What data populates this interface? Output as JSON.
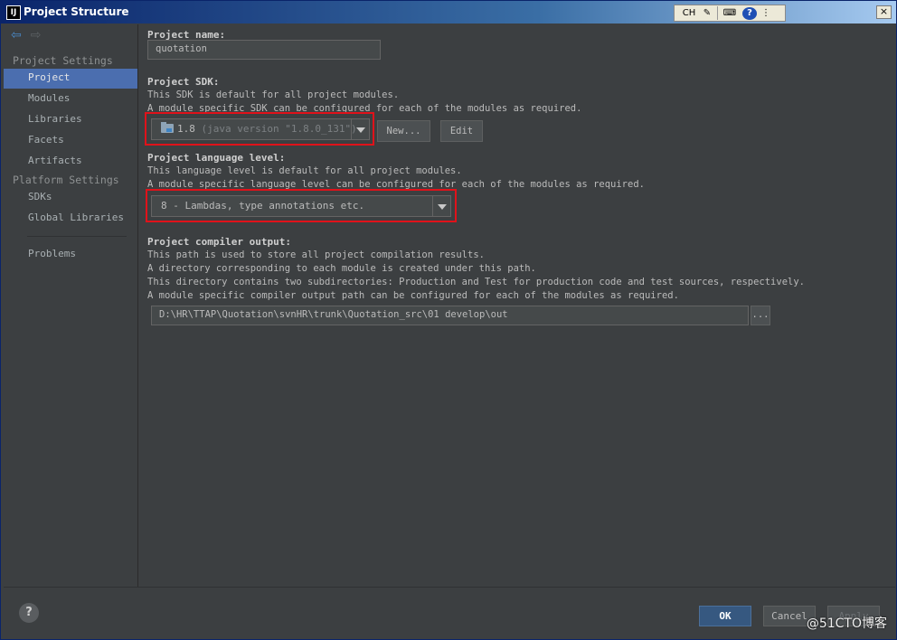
{
  "window": {
    "logo": "IJ",
    "title": "Project Structure",
    "close": "×"
  },
  "ime": {
    "lang": "CH",
    "pen": "✎",
    "keyboard": "⌨",
    "help": "?",
    "menu": "⋮"
  },
  "sidebar": {
    "project_settings_header": "Project Settings",
    "project_items": [
      "Project",
      "Modules",
      "Libraries",
      "Facets",
      "Artifacts"
    ],
    "platform_settings_header": "Platform Settings",
    "platform_items": [
      "SDKs",
      "Global Libraries"
    ],
    "problems": "Problems",
    "active_item": "Project"
  },
  "main": {
    "project_name_label": "Project name:",
    "project_name_value": "quotation",
    "sdk_label": "Project SDK:",
    "sdk_desc_1": "This SDK is default for all project modules.",
    "sdk_desc_2": "A module specific SDK can be configured for each of the modules as required.",
    "sdk_value": "1.8",
    "sdk_version": "(java version \"1.8.0_131\")",
    "sdk_new_button": "New...",
    "sdk_edit_button": "Edit",
    "lang_label": "Project language level:",
    "lang_desc_1": "This language level is default for all project modules.",
    "lang_desc_2": "A module specific language level can be configured for each of the modules as required.",
    "lang_value": "8 - Lambdas, type annotations etc.",
    "compiler_label": "Project compiler output:",
    "compiler_desc_1": "This path is used to store all project compilation results.",
    "compiler_desc_2": "A directory corresponding to each module is created under this path.",
    "compiler_desc_3": "This directory contains two subdirectories: Production and Test for production code and test sources, respectively.",
    "compiler_desc_4": "A module specific compiler output path can be configured for each of the modules as required.",
    "compiler_path": "D:\\HR\\TTAP\\Quotation\\svnHR\\trunk\\Quotation_src\\01 develop\\out",
    "browse_button": "..."
  },
  "footer": {
    "help": "?",
    "ok": "OK",
    "cancel": "Cancel",
    "apply": "Apply"
  },
  "watermark": "@51CTO博客",
  "colors": {
    "highlight": "#e0121a",
    "selection": "#4b6eaf",
    "background": "#3c3f41"
  }
}
